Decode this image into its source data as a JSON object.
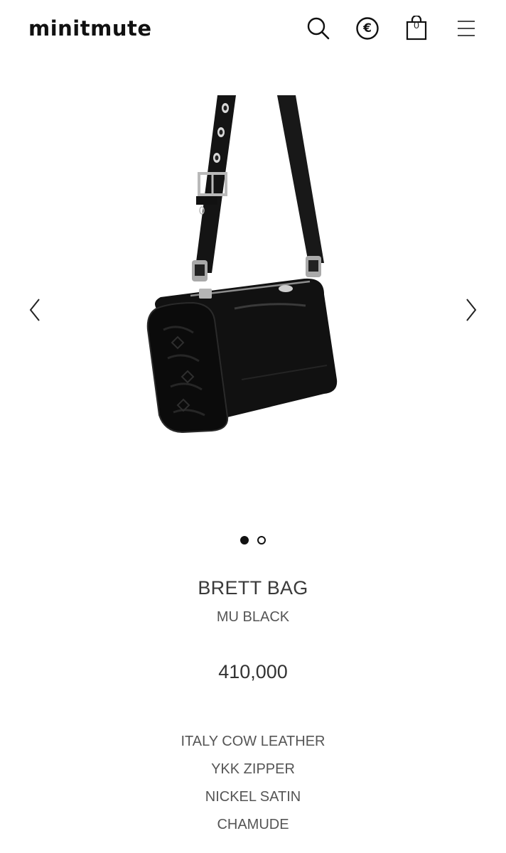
{
  "header": {
    "logo": "minitmute",
    "icons": {
      "search": "search-icon",
      "currency": "currency-icon",
      "cart": "shopping-bag-icon",
      "menu": "hamburger-menu-icon"
    },
    "currency_symbol": "€",
    "cart_count": "0"
  },
  "gallery": {
    "image": "product-photo-black-leather-shoulder-bag",
    "prev_icon": "chevron-left-icon",
    "next_icon": "chevron-right-icon",
    "slides_total": 2,
    "active_slide": 1
  },
  "product": {
    "name": "BRETT BAG",
    "color": "MU BLACK",
    "price": "410,000",
    "specs": [
      "ITALY COW LEATHER",
      "YKK ZIPPER",
      "NICKEL SATIN",
      "CHAMUDE"
    ]
  },
  "colors": {
    "text": "#3a3a3a",
    "logo": "#111111",
    "background": "#ffffff"
  }
}
